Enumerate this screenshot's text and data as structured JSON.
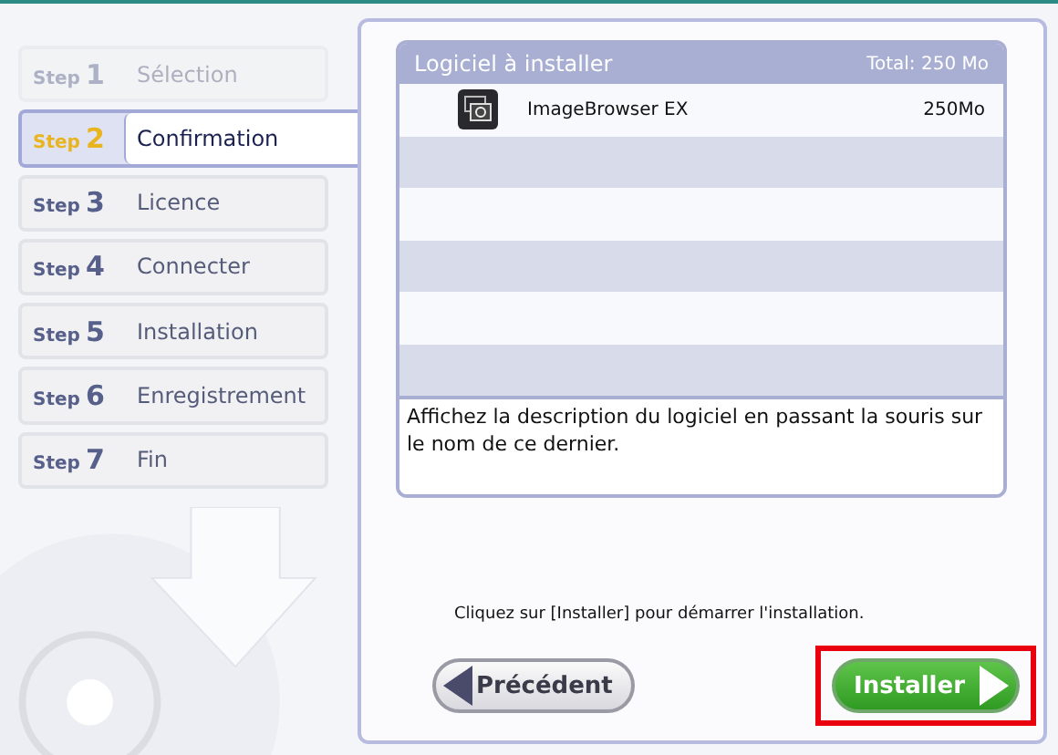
{
  "steps": [
    {
      "prefix": "Step",
      "number": "1",
      "label": "Sélection",
      "selected": false,
      "disabled": true
    },
    {
      "prefix": "Step",
      "number": "2",
      "label": "Confirmation",
      "selected": true,
      "disabled": false
    },
    {
      "prefix": "Step",
      "number": "3",
      "label": "Licence",
      "selected": false,
      "disabled": false
    },
    {
      "prefix": "Step",
      "number": "4",
      "label": "Connecter",
      "selected": false,
      "disabled": false
    },
    {
      "prefix": "Step",
      "number": "5",
      "label": "Installation",
      "selected": false,
      "disabled": false
    },
    {
      "prefix": "Step",
      "number": "6",
      "label": "Enregistrement",
      "selected": false,
      "disabled": false
    },
    {
      "prefix": "Step",
      "number": "7",
      "label": "Fin",
      "selected": false,
      "disabled": false
    }
  ],
  "software_table": {
    "title": "Logiciel à installer",
    "total": "Total: 250 Mo",
    "rows": [
      {
        "name": "ImageBrowser EX",
        "size": "250Mo"
      }
    ],
    "description": "Affichez la description du logiciel en passant la souris sur le nom de ce dernier."
  },
  "instruction": "Cliquez sur [Installer] pour démarrer l'installation.",
  "back_button": {
    "label": "Précédent"
  },
  "install_button": {
    "label": "Installer",
    "highlighted": true
  }
}
